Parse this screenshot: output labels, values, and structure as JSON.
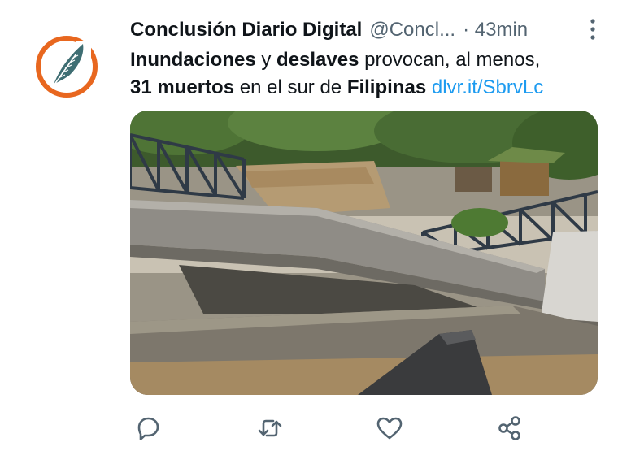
{
  "tweet": {
    "author_name": "Conclusión Diario Digital",
    "handle": "@Concl...",
    "time": "· 43min",
    "text_parts": {
      "p1": "Inundaciones",
      "p2": " y ",
      "p3": "deslaves",
      "p4": " provocan, al menos, ",
      "p5": "31 muertos",
      "p6": " en el sur de ",
      "p7": "Filipinas",
      "p8": " ",
      "link": "dlvr.it/SbrvLc"
    }
  },
  "icons": {
    "avatar": "feather-logo",
    "more": "more-vertical-icon",
    "reply": "reply-icon",
    "retweet": "retweet-icon",
    "like": "heart-icon",
    "share": "share-icon"
  },
  "colors": {
    "text": "#0f1419",
    "secondary": "#536471",
    "link": "#1d9bf0",
    "logo_ring": "#e8671f",
    "logo_feather": "#3f6e73"
  }
}
